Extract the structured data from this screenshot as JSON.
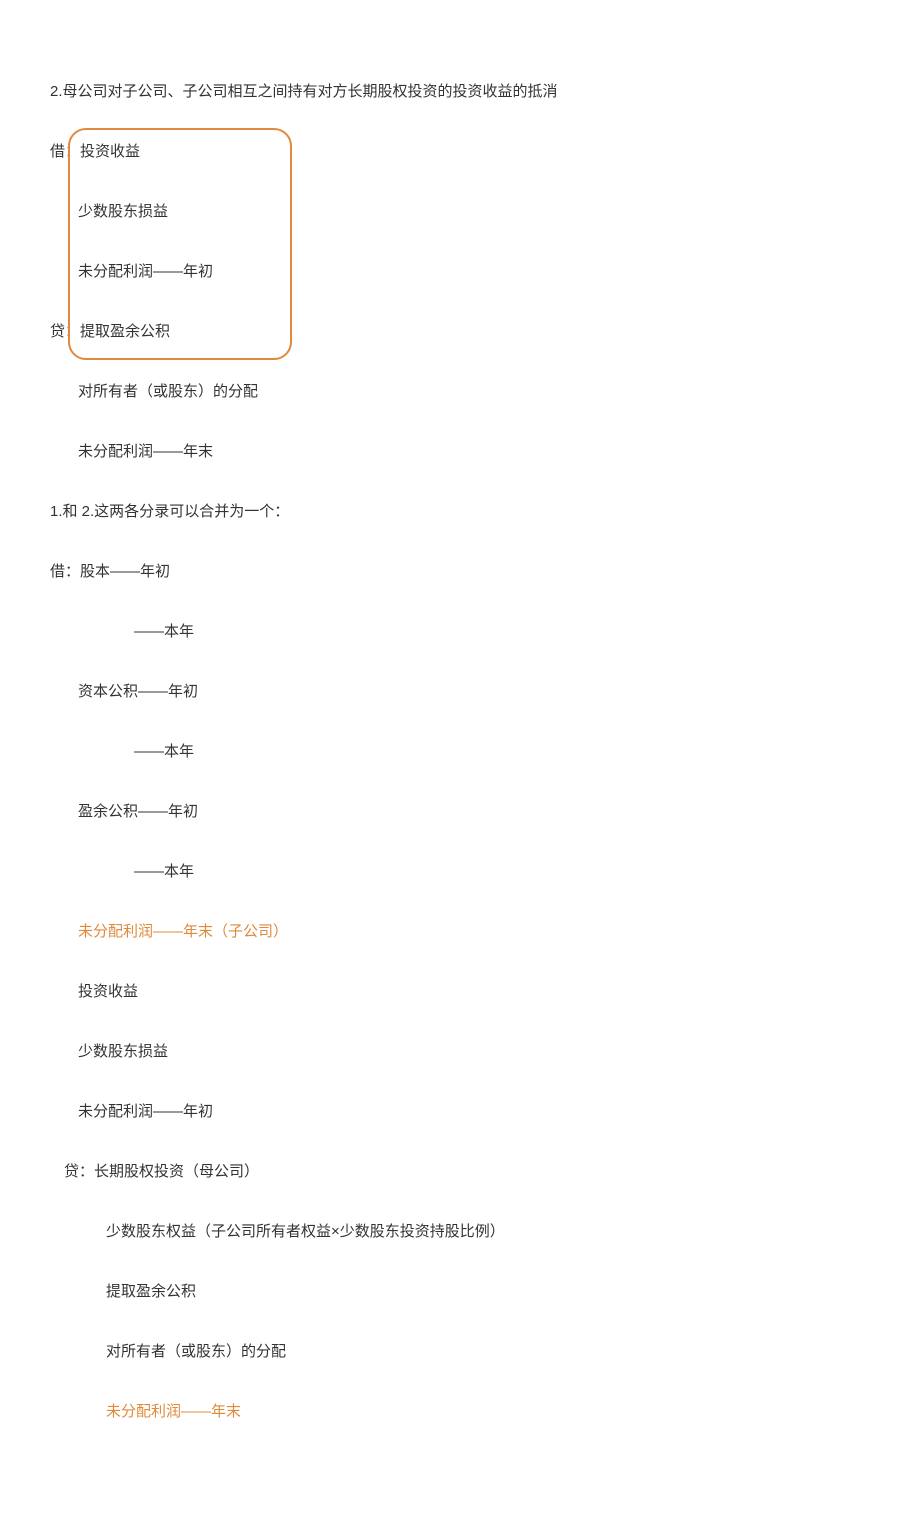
{
  "title": "2.母公司对子公司、子公司相互之间持有对方长期股权投资的投资收益的抵消",
  "section1": {
    "line1": "借：投资收益",
    "line2": "少数股东损益",
    "line3": "未分配利润——年初",
    "line4_label": "贷：",
    "line4_text": "提取盈余公积",
    "line5": "对所有者（或股东）的分配",
    "line6": "未分配利润——年末"
  },
  "section2": {
    "intro": "1.和 2.这两各分录可以合并为一个：",
    "line1": "借：股本——年初",
    "line2": "——本年",
    "line3": "资本公积——年初",
    "line4": "——本年",
    "line5": "盈余公积——年初",
    "line6": "——本年",
    "line7_orange": "未分配利润——年末（子公司）",
    "line8": "投资收益",
    "line9": "少数股东损益",
    "line10": "未分配利润——年初",
    "line11": "贷：长期股权投资（母公司）",
    "line12": "少数股东权益（子公司所有者权益×少数股东投资持股比例）",
    "line13": "提取盈余公积",
    "line14": "对所有者（或股东）的分配",
    "line15_orange": "未分配利润——年末"
  }
}
